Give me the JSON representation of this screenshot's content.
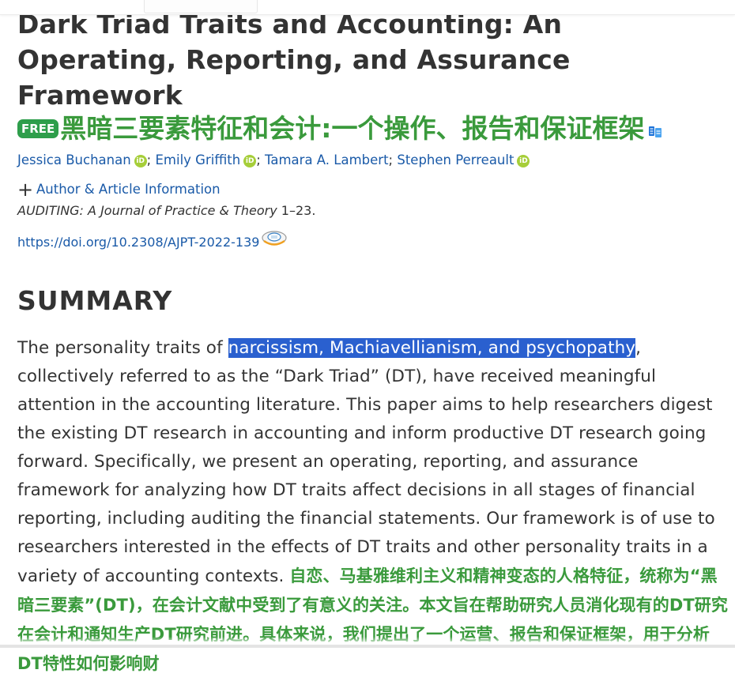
{
  "article": {
    "title": "Dark Triad Traits and Accounting: An Operating, Reporting, and Assurance Framework",
    "free_badge": "FREE",
    "title_translation": "黑暗三要素特征和会计:一个操作、报告和保证框架",
    "authors": [
      {
        "name": "Jessica Buchanan",
        "orcid": true
      },
      {
        "name": "Emily Griffith",
        "orcid": true
      },
      {
        "name": "Tamara A. Lambert",
        "orcid": false
      },
      {
        "name": "Stephen Perreault",
        "orcid": true
      }
    ],
    "orcid_label": "iD",
    "author_separator": ";",
    "info_toggle_label": "Author & Article Information",
    "journal": "AUDITING: A Journal of Practice & Theory",
    "pages": "1–23.",
    "doi": "https://doi.org/10.2308/AJPT-2022-139"
  },
  "summary": {
    "heading": "SUMMARY",
    "text_before_highlight": "The personality traits of ",
    "highlighted_text": "narcissism, Machiavellianism, and psychopathy",
    "text_after_highlight": ", collectively referred to as the “Dark Triad” (DT), have received meaningful attention in the accounting literature. This paper aims to help researchers digest the existing DT research in accounting and inform productive DT research going forward. Specifically, we present an operating, reporting, and assurance framework for analyzing how DT traits affect decisions in all stages of financial reporting, including auditing the financial statements. Our framework is of use to researchers interested in the effects of DT traits and other personality traits in a variety of accounting contexts.",
    "translation": "自恋、马基雅维利主义和精神变态的人格特征，统称为“黑暗三要素”(DT)，在会计文献中受到了有意义的关注。本文旨在帮助研究人员消化现有的DT研究在会计和通知生产DT研究前进。具体来说，我们提出了一个运营、报告和保证框架，用于分析DT特性如何影响财"
  },
  "colors": {
    "link": "#1a5aa8",
    "translation_green": "#3a9a3c",
    "free_badge_green": "#2e9e4b",
    "orcid_green": "#a6ce39",
    "selection_blue": "#2a60cf"
  },
  "icons": {
    "translate": "translate-icon",
    "plus": "plus-icon",
    "orcid": "orcid-icon",
    "doi_badge": "crossmark-icon"
  }
}
